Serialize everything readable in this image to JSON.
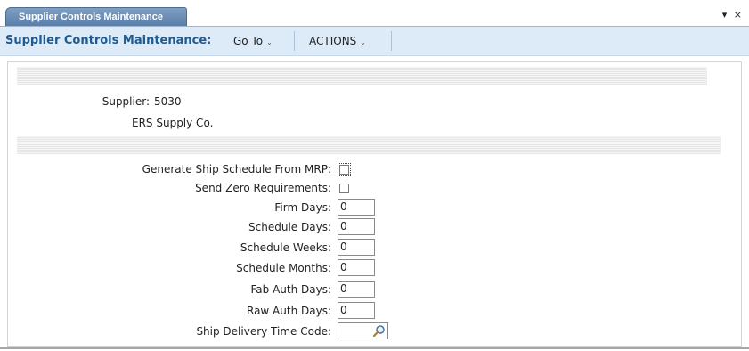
{
  "tab": {
    "label": "Supplier Controls Maintenance"
  },
  "window_controls": {
    "dropdown": "▾",
    "close": "×"
  },
  "toolbar": {
    "title": "Supplier Controls Maintenance:",
    "goto_label": "Go To",
    "actions_label": "ACTIONS",
    "chevron": "⌄"
  },
  "supplier": {
    "label": "Supplier:",
    "code": "5030",
    "name": "ERS Supply Co."
  },
  "fields": {
    "generate_ship_schedule": {
      "label": "Generate Ship Schedule From MRP:",
      "checked": false
    },
    "send_zero_requirements": {
      "label": "Send Zero Requirements:",
      "checked": false
    },
    "firm_days": {
      "label": "Firm Days:",
      "value": "0"
    },
    "schedule_days": {
      "label": "Schedule Days:",
      "value": "0"
    },
    "schedule_weeks": {
      "label": "Schedule Weeks:",
      "value": "0"
    },
    "schedule_months": {
      "label": "Schedule Months:",
      "value": "0"
    },
    "fab_auth_days": {
      "label": "Fab Auth Days:",
      "value": "0"
    },
    "raw_auth_days": {
      "label": "Raw Auth Days:",
      "value": "0"
    },
    "ship_delivery_time_code": {
      "label": "Ship Delivery Time Code:",
      "value": ""
    }
  },
  "colors": {
    "tab_bg": "#6a8db5",
    "toolbar_bg": "#dcebf7",
    "title_text": "#1f5a91"
  }
}
